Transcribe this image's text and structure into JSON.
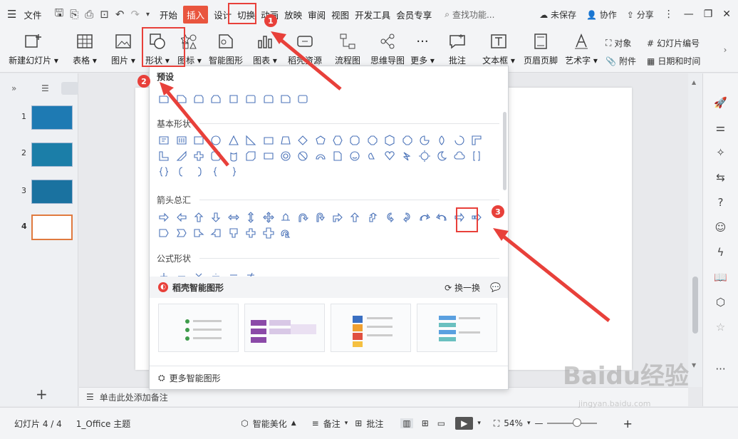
{
  "menubar": {
    "file": "文件",
    "tabs": [
      "开始",
      "插入",
      "设计",
      "切换",
      "动画",
      "放映",
      "审阅",
      "视图",
      "开发工具",
      "会员专享"
    ],
    "search_placeholder": "查找功能...",
    "unsaved": "未保存",
    "collab": "协作",
    "share": "分享"
  },
  "ribbon": {
    "new_slide": "新建幻灯片",
    "table": "表格",
    "picture": "图片",
    "shape": "形状",
    "icon": "图标",
    "smart_art": "智能图形",
    "chart": "图表",
    "docer": "稻壳资源",
    "flowchart": "流程图",
    "mindmap": "思维导图",
    "more": "更多",
    "comment": "批注",
    "textbox": "文本框",
    "header_footer": "页眉页脚",
    "wordart": "艺术字",
    "object": "对象",
    "slide_number": "幻灯片编号",
    "attachment": "附件",
    "datetime": "日期和时间"
  },
  "slides": [
    {
      "num": "1"
    },
    {
      "num": "2"
    },
    {
      "num": "3"
    },
    {
      "num": "4"
    }
  ],
  "dropdown": {
    "preset": "预设",
    "basic_shapes": "基本形状",
    "arrows": "箭头总汇",
    "formula": "公式形状",
    "smart_graphics": "稻壳智能图形",
    "swap": "换一换",
    "more_smart": "更多智能图形"
  },
  "notes_placeholder": "单击此处添加备注",
  "status": {
    "slide_info": "幻灯片 4 / 4",
    "theme": "1_Office 主题",
    "beautify": "智能美化",
    "notes": "备注",
    "comments": "批注",
    "zoom": "54%"
  },
  "badges": [
    "1",
    "2",
    "3"
  ],
  "watermark": {
    "main": "Baidu经验",
    "sub": "jingyan.baidu.com"
  },
  "colors": {
    "accent": "#e9553e",
    "annotation": "#e8403a",
    "shape_stroke": "#4a72b8"
  }
}
